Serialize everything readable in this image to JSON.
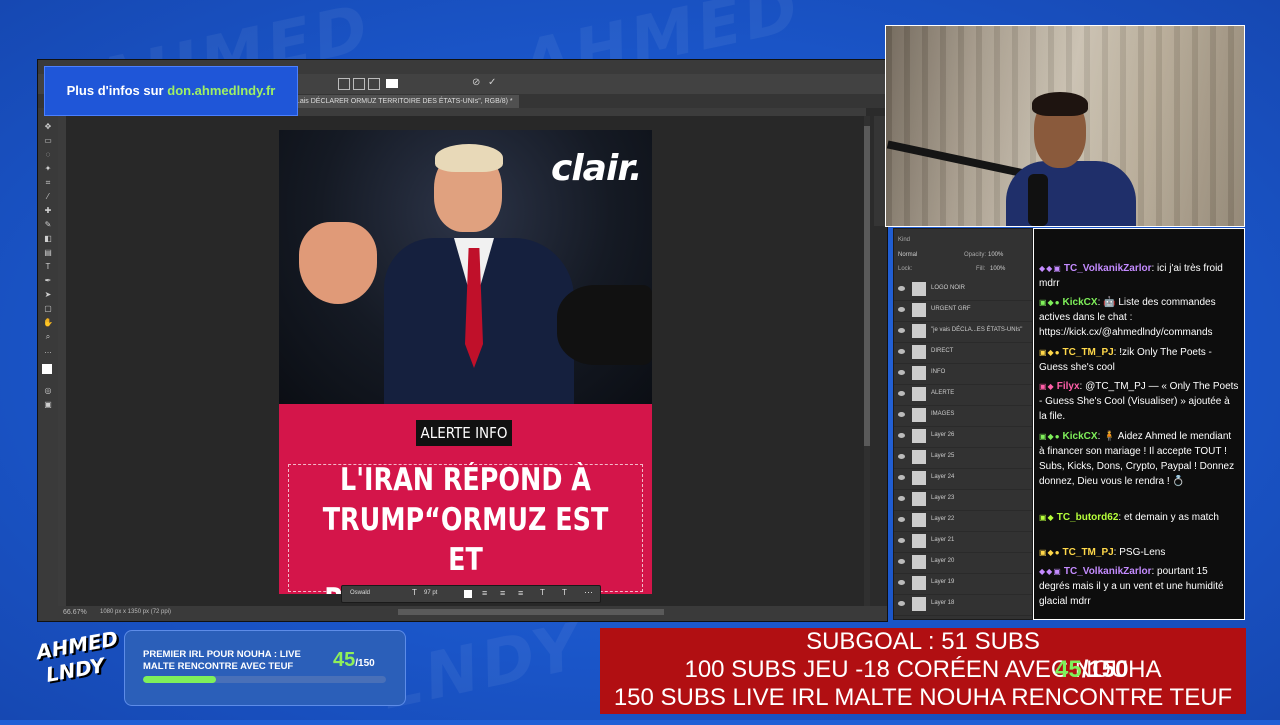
{
  "info_banner": {
    "prefix": "Plus d'infos sur",
    "link": "don.ahmedlndy.fr"
  },
  "photoshop": {
    "doc_tab": "...ais DÉCLARER ORMUZ TERRITOIRE DES ÉTATS-UNIs\", RGB/8) *",
    "zoom": "66.67%",
    "doc_size": "1080 px x 1350 px (72 ppi)",
    "font_family": "Oswald",
    "font_size": "97 pt",
    "layers_search": "Kind",
    "blend_mode": "Normal",
    "opacity_label": "Opacity:",
    "opacity_value": "100%",
    "lock_label": "Lock:",
    "fill_label": "Fill:",
    "fill_value": "100%",
    "layers": [
      "LOGO NOIR",
      "URGENT GRF",
      "\"je vais DÉCLA...ES ÉTATS-UNIs\"",
      "DIRECT",
      "INFO",
      "ALERTE",
      "IMAGES",
      "Layer 26",
      "Layer 25",
      "Layer 24",
      "Layer 23",
      "Layer 22",
      "Layer 21",
      "Layer 20",
      "Layer 19",
      "Layer 18"
    ]
  },
  "document": {
    "brand": "clair.",
    "alert_badge": "ALERTE INFO",
    "headline_line1": "L'IRAN RÉPOND À",
    "headline_line2": "TRUMP“ORMUZ EST ET",
    "headline_line3": "RESTERA IRANIEN”,"
  },
  "chat": [
    {
      "badges": "◆◆▣",
      "user": "TC_VolkanikZarlor",
      "color": "#c48bff",
      "text": ": ici j'ai très froid mdrr"
    },
    {
      "badges": "▣◆●",
      "user": "KickCX",
      "color": "#7ff05a",
      "text": ": 🤖 Liste des commandes actives dans le chat : https://kick.cx/@ahmedlndy/commands"
    },
    {
      "badges": "▣◆●",
      "user": "TC_TM_PJ",
      "color": "#ffd84a",
      "text": ": !zik Only The Poets - Guess she's cool"
    },
    {
      "badges": "▣◆",
      "user": "Filyx",
      "color": "#ff5fa8",
      "text": ": @TC_TM_PJ — « Only The Poets - Guess She's Cool (Visualiser) » ajoutée à la file."
    },
    {
      "badges": "▣◆●",
      "user": "KickCX",
      "color": "#7ff05a",
      "text": ": 🧍 Aidez Ahmed le mendiant à financer son mariage ! Il accepte TOUT ! Subs, Kicks, Dons, Crypto, Paypal ! Donnez donnez, Dieu vous le rendra ! 💍"
    },
    {
      "badges": "▣◆",
      "user": "TC_butord62",
      "color": "#b6ff3a",
      "text": ": et demain y as match"
    },
    {
      "badges": "▣◆●",
      "user": "TC_TM_PJ",
      "color": "#ffd84a",
      "text": ": PSG-Lens"
    },
    {
      "badges": "◆◆▣",
      "user": "TC_VolkanikZarlor",
      "color": "#c48bff",
      "text": ": pourtant 15 degrés mais il y a un vent et une humidité glacial mdrr"
    }
  ],
  "goal_widget": {
    "title": "PREMIER IRL POUR NOUHA : LIVE MALTE RENCONTRE AVEC TEUF",
    "current": "45",
    "total": "/150",
    "progress": 0.3
  },
  "subgoal": {
    "line1": "SUBGOAL : 51 SUBS",
    "line2": "100 SUBS JEU -18 CORÉEN AVEC NOUHA",
    "line3": "150 SUBS LIVE IRL MALTE NOUHA RENCONTRE TEUF",
    "count": "45",
    "count_total": "/150"
  },
  "logo": {
    "line1": "AHMED",
    "line2": "LNDY"
  },
  "colors": {
    "accent_green": "#7ef05b",
    "alert_red": "#d4154a",
    "subgoal_red": "#b10f12"
  }
}
